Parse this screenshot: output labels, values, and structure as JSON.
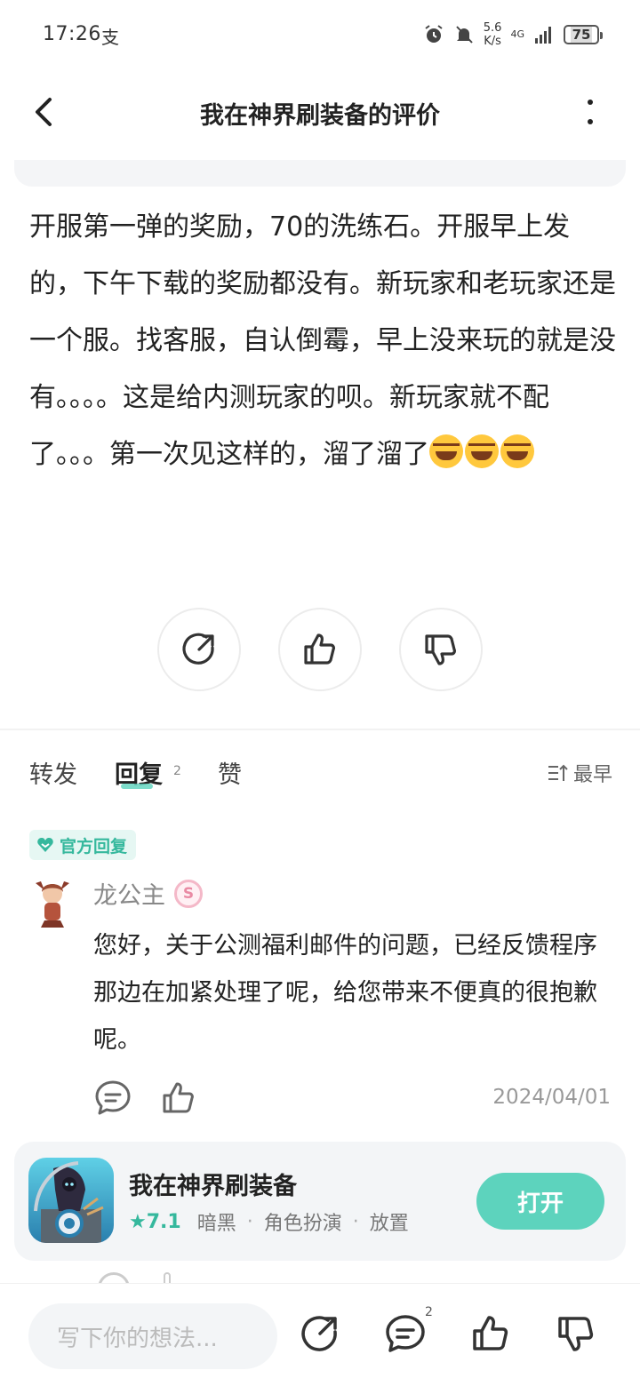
{
  "status_bar": {
    "time": "17:26",
    "time_icon": "支",
    "speed_value": "5.6",
    "speed_unit": "K/s",
    "network": "4G",
    "battery": "75"
  },
  "header": {
    "title": "我在神界刷装备的评价"
  },
  "review": {
    "text": "开服第一弹的奖励，70的洗练石。开服早上发的，下午下载的奖励都没有。新玩家和老玩家还是一个服。找客服，自认倒霉，早上没来玩的就是没有。。。。这是给内测玩家的呗。新玩家就不配了。。。第一次见这样的，溜了溜了"
  },
  "tabs": {
    "forward": "转发",
    "reply": "回复",
    "reply_count": "2",
    "like": "赞",
    "sort": "最早"
  },
  "official_reply": {
    "badge": "官方回复",
    "user": "龙公主",
    "text": "您好，关于公测福利邮件的问题，已经反馈程序那边在加紧处理了呢，给您带来不便真的很抱歉呢。",
    "date": "2024/04/01"
  },
  "app_card": {
    "name": "我在神界刷装备",
    "rating": "★7.1",
    "tags": [
      "暗黑",
      "角色扮演",
      "放置"
    ],
    "open_label": "打开"
  },
  "bottom_bar": {
    "placeholder": "写下你的想法...",
    "comment_count": "2"
  },
  "colors": {
    "accent": "#5dd3bd",
    "accent_text": "#35b89d"
  }
}
